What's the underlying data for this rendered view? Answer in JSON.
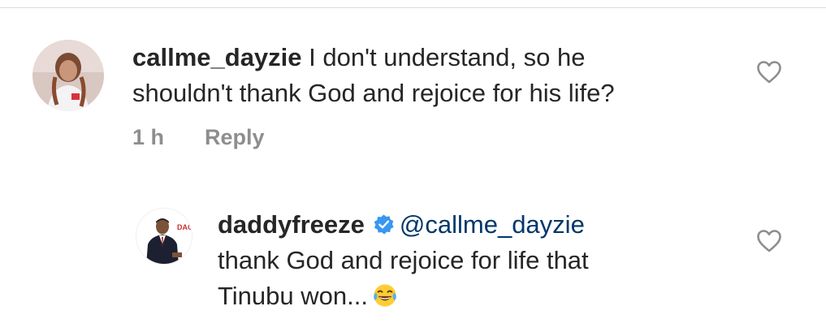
{
  "comment1": {
    "username": "callme_dayzie",
    "text_line1": "I don't understand, so he",
    "text_line2": "shouldn't thank God and rejoice for his life?",
    "time": "1 h",
    "reply_label": "Reply",
    "avatar_icon": "profile-photo",
    "like_icon": "heart-outline-icon"
  },
  "reply1": {
    "username": "daddyfreeze",
    "mention": "@callme_dayzie",
    "text_line1": "thank God and rejoice for life that",
    "text_line2": "Tinubu won...",
    "verified_icon": "verified-badge-icon",
    "emoji_icon": "tears-of-joy-emoji",
    "avatar_icon": "profile-photo",
    "like_icon": "heart-outline-icon"
  },
  "colors": {
    "text": "#262626",
    "secondary": "#8e8e8e",
    "mention": "#00376b",
    "verified": "#3897f0"
  }
}
